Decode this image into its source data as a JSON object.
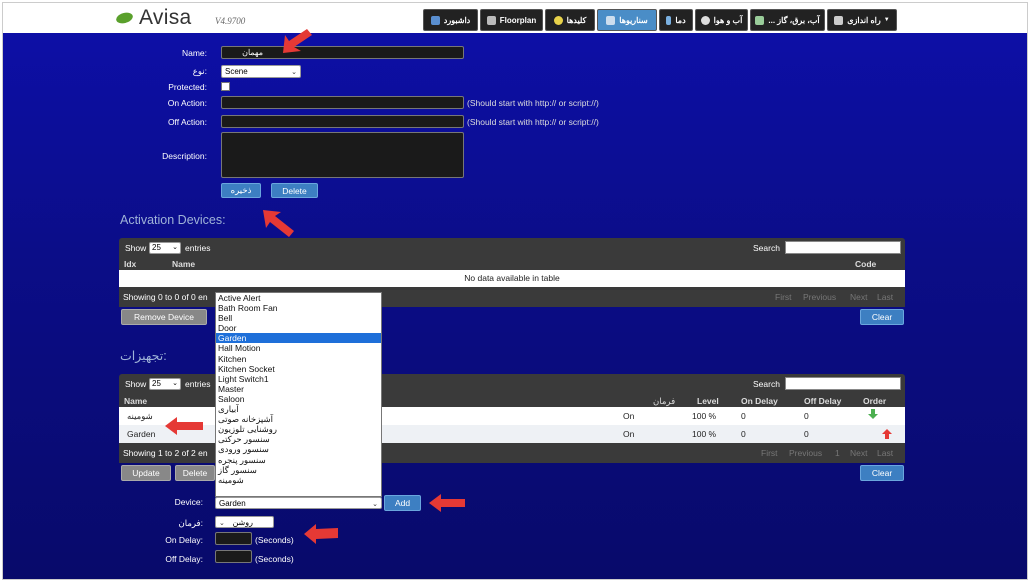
{
  "app": {
    "name": "Avisa",
    "version": "V4.9700"
  },
  "nav": {
    "tabs": [
      {
        "label": "داشبورد",
        "icon": "dashboard-icon",
        "active": false
      },
      {
        "label": "Floorplan",
        "icon": "floorplan-icon",
        "active": false
      },
      {
        "label": "کلیدها",
        "icon": "bulb-icon",
        "active": false
      },
      {
        "label": "سناریوها",
        "icon": "scenes-icon",
        "active": true
      },
      {
        "label": "دما",
        "icon": "thermometer-icon",
        "active": false
      },
      {
        "label": "آب و هوا",
        "icon": "weather-icon",
        "active": false
      },
      {
        "label": "... آب، برق، گاز",
        "icon": "utility-icon",
        "active": false
      },
      {
        "label": "راه اندازی",
        "icon": "tools-icon",
        "active": false
      }
    ]
  },
  "form": {
    "name_label": "Name:",
    "name_value": "مهمان",
    "type_label": "نوع:",
    "type_value": "Scene",
    "protected_label": "Protected:",
    "on_action_label": "On Action:",
    "on_action_hint": "(Should start with http:// or script://)",
    "off_action_label": "Off Action:",
    "off_action_hint": "(Should start with http:// or script://)",
    "description_label": "Description:",
    "save_label": "ذخیره",
    "delete_label": "Delete"
  },
  "activation": {
    "title": "Activation Devices:",
    "show_label": "Show",
    "show_value": "25",
    "entries_label": "entries",
    "search_label": "Search",
    "columns": {
      "idx": "Idx",
      "name": "Name",
      "code": "Code"
    },
    "empty": "No data available in table",
    "info": "Showing 0 to 0 of 0 en",
    "pager": [
      "First",
      "Previous",
      "Next",
      "Last"
    ],
    "remove_label": "Remove Device",
    "clear_label": "Clear"
  },
  "devices": {
    "title": "تجهیزات:",
    "show_label": "Show",
    "show_value": "25",
    "entries_label": "entries",
    "search_label": "Search",
    "columns": {
      "name": "Name",
      "command": "فرمان",
      "level": "Level",
      "on_delay": "On Delay",
      "off_delay": "Off Delay",
      "order": "Order"
    },
    "rows": [
      {
        "name": "شومینه",
        "command": "On",
        "level": "100 %",
        "on_delay": "0",
        "off_delay": "0"
      },
      {
        "name": "Garden",
        "command": "On",
        "level": "100 %",
        "on_delay": "0",
        "off_delay": "0"
      }
    ],
    "info": "Showing 1 to 2 of 2 en",
    "pager": [
      "First",
      "Previous",
      "1",
      "Next",
      "Last"
    ],
    "update_label": "Update",
    "delete_label": "Delete",
    "clear_label": "Clear"
  },
  "add_device": {
    "device_label": "Device:",
    "device_value": "Garden",
    "add_label": "Add",
    "command_label": "فرمان:",
    "command_value": "روشن",
    "on_delay_label": "On Delay:",
    "off_delay_label": "Off Delay:",
    "seconds": "(Seconds)"
  },
  "dropdown_options": [
    "Active Alert",
    "Bath Room Fan",
    "Bell",
    "Door",
    "Garden",
    "Hall Motion",
    "Kitchen",
    "Kitchen Socket",
    "Light Switch1",
    "Master",
    "Saloon",
    "آبیاری",
    "آشپزخانه صوتی",
    "روشنایی تلوزیون",
    "سنسور حرکتی",
    "سنسور ورودی",
    "سنسور پنجره",
    "سنسور گاز",
    "شومینه"
  ],
  "dropdown_selected": "Garden",
  "colors": {
    "accent": "#3d7fc2",
    "background": "#0b0d88",
    "arrow": "#e53935"
  }
}
